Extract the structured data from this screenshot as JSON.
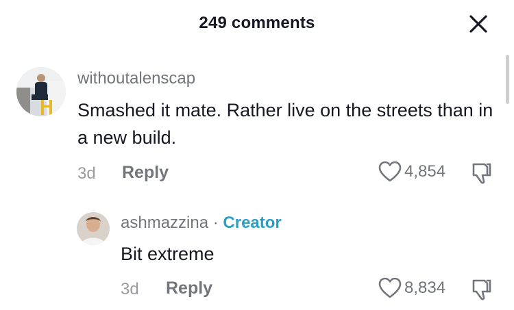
{
  "header": {
    "title": "249 comments"
  },
  "comments": [
    {
      "username": "withoutalenscap",
      "text": "Smashed it mate. Rather live on the streets than in a new build.",
      "time": "3d",
      "reply_label": "Reply",
      "likes": "4,854"
    },
    {
      "username": "ashmazzina",
      "separator": "·",
      "badge": "Creator",
      "text": "Bit extreme",
      "time": "3d",
      "reply_label": "Reply",
      "likes": "8,834"
    }
  ],
  "icons": {
    "close": "close-icon",
    "like": "heart-icon",
    "dislike": "thumbs-down-icon"
  },
  "colors": {
    "text": "#161823",
    "muted": "#73757c",
    "creator": "#2a9fc2"
  }
}
